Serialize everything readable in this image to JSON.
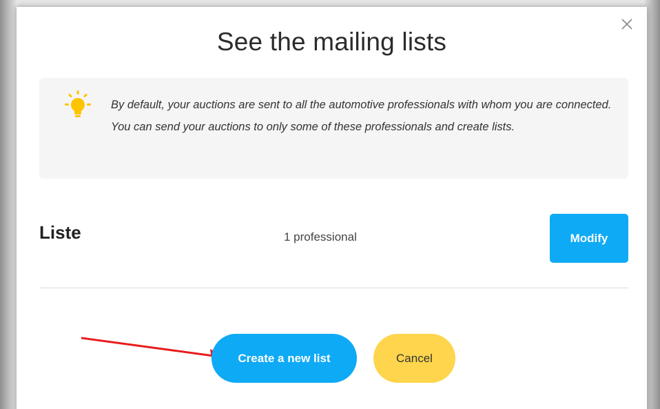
{
  "dialog": {
    "title": "See the mailing lists",
    "close_icon": "close-icon",
    "info": {
      "icon": "lightbulb-icon",
      "text": "By default, your auctions are sent to all the automotive professionals with whom you are connected. You can send your auctions to only some of these professionals and create lists."
    },
    "lists": [
      {
        "name": "Liste",
        "count_label": "1 professional",
        "modify_label": "Modify"
      }
    ],
    "create_label": "Create a new list",
    "cancel_label": "Cancel"
  },
  "colors": {
    "primary": "#0eaaf5",
    "cancel": "#fed54c",
    "info_bg": "#f5f5f5",
    "bulb": "#ffc400",
    "annotation_arrow": "#e81c1c"
  }
}
